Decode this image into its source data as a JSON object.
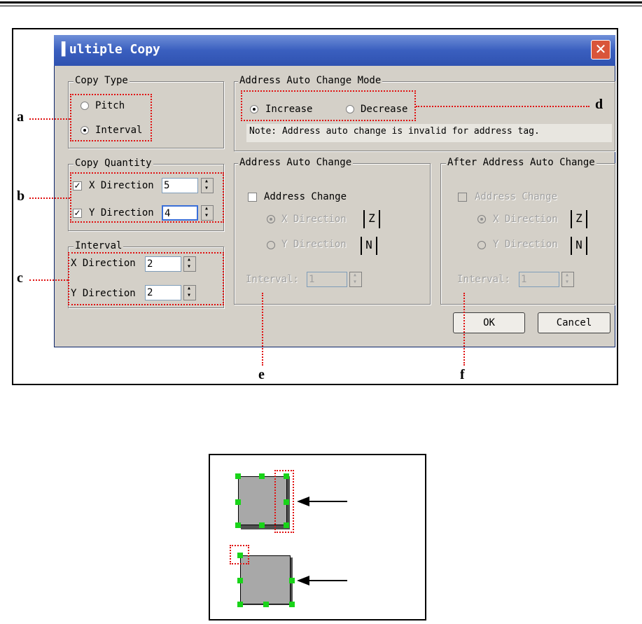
{
  "dialog": {
    "title": "Multiple Copy",
    "title_display": "▌ultiple Copy",
    "close_label": "✕",
    "copy_type": {
      "legend": "Copy Type",
      "options": [
        "Pitch",
        "Interval"
      ],
      "selected": "Interval"
    },
    "copy_quantity": {
      "legend": "Copy Quantity",
      "x_label": "X Direction",
      "x_value": "5",
      "y_label": "Y Direction",
      "y_value": "4"
    },
    "interval": {
      "legend": "Interval",
      "x_label": "X Direction",
      "x_value": "2",
      "y_label": "Y Direction",
      "y_value": "2"
    },
    "address_mode": {
      "legend": "Address Auto Change Mode",
      "options": [
        "Increase",
        "Decrease"
      ],
      "selected": "Increase",
      "note": "Note: Address auto change is invalid for address tag."
    },
    "address_auto_change": {
      "legend": "Address Auto Change",
      "checkbox": "Address Change",
      "x_label": "X Direction",
      "y_label": "Y Direction",
      "interval_label": "Interval:",
      "interval_value": "1"
    },
    "after_address_auto_change": {
      "legend": "After Address Auto Change",
      "checkbox": "Address Change",
      "x_label": "X Direction",
      "y_label": "Y Direction",
      "interval_label": "Interval:",
      "interval_value": "1"
    },
    "ok_label": "OK",
    "cancel_label": "Cancel"
  },
  "callouts": [
    "a",
    "b",
    "c",
    "d",
    "e",
    "f"
  ],
  "icons": {
    "x_direction_icon": "Z",
    "y_direction_icon": "N"
  },
  "colors": {
    "title_bar": "#3a5fbf",
    "dialog_bg": "#d4d0c8",
    "callout_red": "#e01010",
    "handle_green": "#19d419"
  }
}
